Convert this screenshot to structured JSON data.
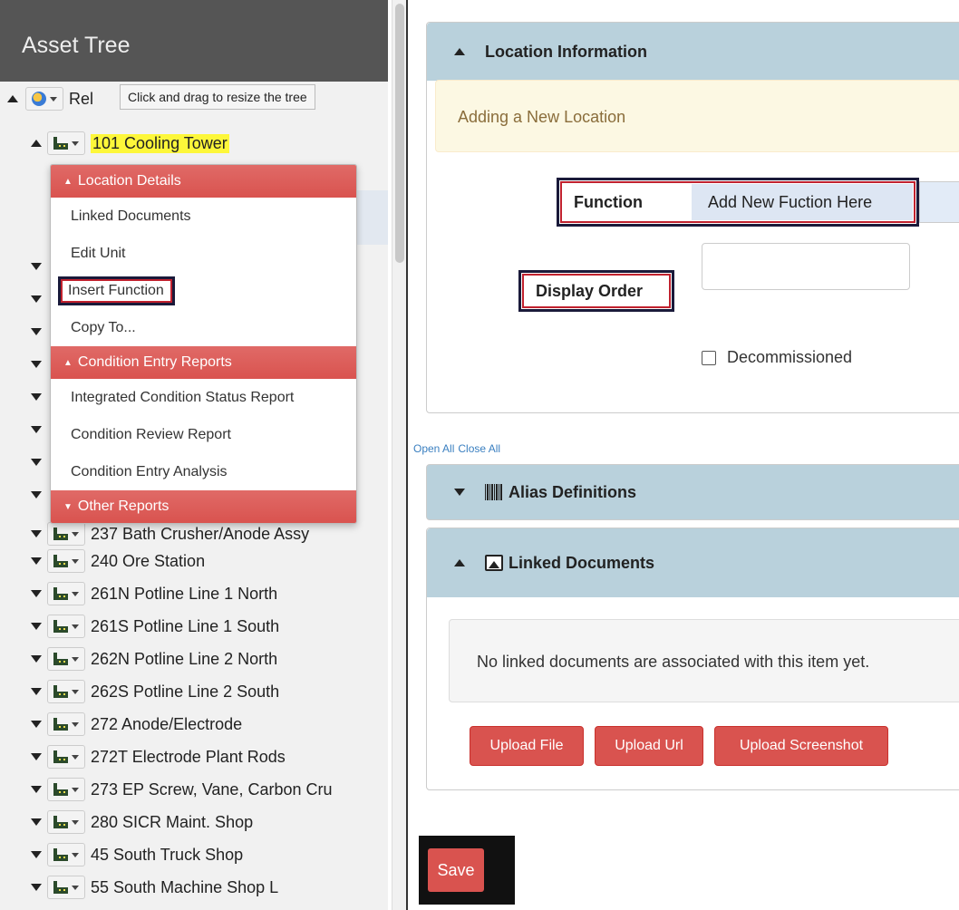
{
  "tree": {
    "header": "Asset Tree",
    "root_label": "Rel",
    "tooltip": "Click and drag to resize the tree",
    "selected_node": "101 Cooling Tower",
    "partial_node": "237 Bath Crusher/Anode Assy",
    "nodes": [
      "240 Ore Station",
      "261N Potline Line 1 North",
      "261S Potline Line 1 South",
      "262N Potline Line 2 North",
      "262S Potline Line 2 South",
      "272 Anode/Electrode",
      "272T Electrode Plant Rods",
      "273 EP Screw, Vane, Carbon Cru",
      "280 SICR Maint. Shop",
      "45 South Truck Shop",
      "55 South Machine Shop L"
    ]
  },
  "menu": {
    "section1": "Location Details",
    "items1": [
      "Linked Documents",
      "Edit Unit",
      "Insert Function",
      "Copy To..."
    ],
    "section2": "Condition Entry Reports",
    "items2": [
      "Integrated Condition Status Report",
      "Condition Review Report",
      "Condition Entry Analysis"
    ],
    "section3": "Other Reports"
  },
  "location": {
    "title": "Location Information",
    "alert": "Adding a New Location",
    "function_label": "Function",
    "function_value": "Add New Fuction Here",
    "display_order_label": "Display Order",
    "display_order_value": "",
    "decommissioned_label": "Decommissioned"
  },
  "links": {
    "open_all": "Open All",
    "close_all": "Close All"
  },
  "alias": {
    "title": "Alias Definitions"
  },
  "linked_docs": {
    "title": "Linked Documents",
    "empty_text": "No linked documents are associated with this item yet.",
    "upload_file": "Upload File",
    "upload_url": "Upload Url",
    "upload_screenshot": "Upload Screenshot"
  },
  "save_label": "Save"
}
